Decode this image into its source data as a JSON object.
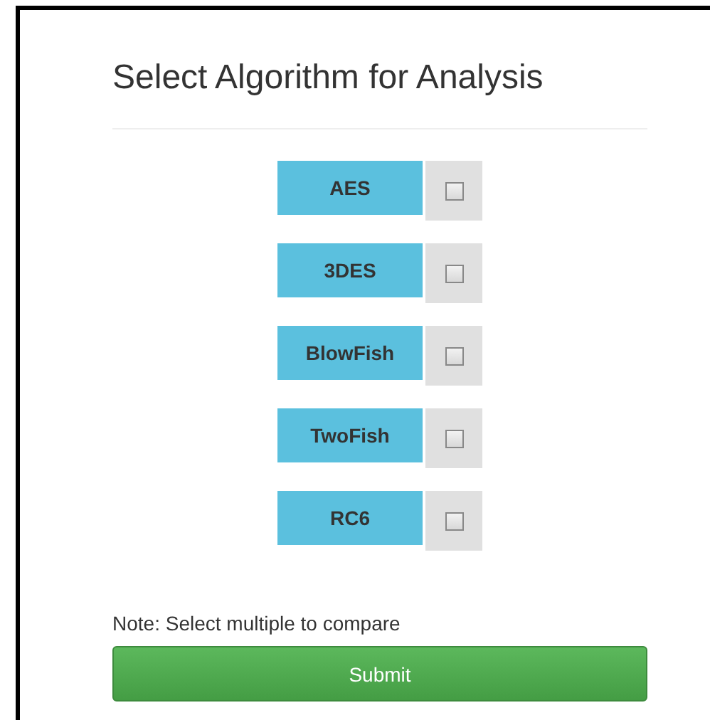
{
  "title": "Select Algorithm for Analysis",
  "algorithms": [
    {
      "label": "AES",
      "checked": false
    },
    {
      "label": "3DES",
      "checked": false
    },
    {
      "label": "BlowFish",
      "checked": false
    },
    {
      "label": "TwoFish",
      "checked": false
    },
    {
      "label": "RC6",
      "checked": false
    }
  ],
  "note": "Note: Select multiple to compare",
  "submit": "Submit"
}
